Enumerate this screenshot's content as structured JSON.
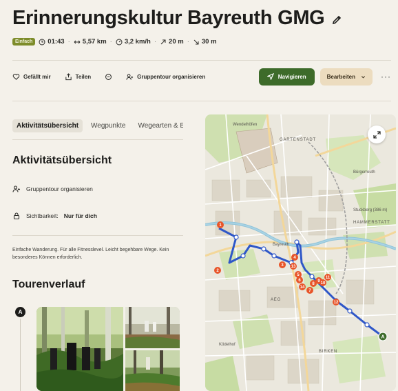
{
  "tour": {
    "title": "Erinnerungskultur Bayreuth GMG",
    "difficulty": "Einfach",
    "duration": "01:43",
    "distance": "5,57 km",
    "speed": "3,2 km/h",
    "ascent": "20 m",
    "descent": "30 m"
  },
  "actions": {
    "like": "Gefällt mir",
    "share": "Teilen",
    "group_tour": "Gruppentour organisieren",
    "navigate": "Navigieren",
    "edit": "Bearbeiten"
  },
  "tabs": [
    "Aktivitätsübersicht",
    "Wegpunkte",
    "Wegearten & Beläge"
  ],
  "overview": {
    "heading": "Aktivitätsübersicht",
    "group_tour": "Gruppentour organisieren",
    "visibility_label": "Sichtbarkeit:",
    "visibility_value": "Nur für dich",
    "description": "Einfache Wanderung. Für alle Fitnesslevel. Leicht begehbare Wege. Kein besonderes Können erforderlich."
  },
  "course": {
    "heading": "Tourenverlauf",
    "start_marker": "A"
  },
  "map": {
    "labels": [
      "Wendelhöfen",
      "GARTENSTADT",
      "Bayreuth",
      "Bürgerreuth",
      "Stuckberg (386 m)",
      "HAMMERSTATT",
      "AEG",
      "BIRKEN",
      "Ködelhof"
    ],
    "end_marker": "A",
    "waypoints": [
      "1",
      "2",
      "3",
      "4",
      "5",
      "6",
      "7",
      "8",
      "9",
      "10",
      "11",
      "12",
      "13",
      "14"
    ]
  },
  "colors": {
    "accent": "#3d6b2a",
    "route": "#2f57c8",
    "waypoint": "#e8552a",
    "badge": "#7d8c2a"
  }
}
